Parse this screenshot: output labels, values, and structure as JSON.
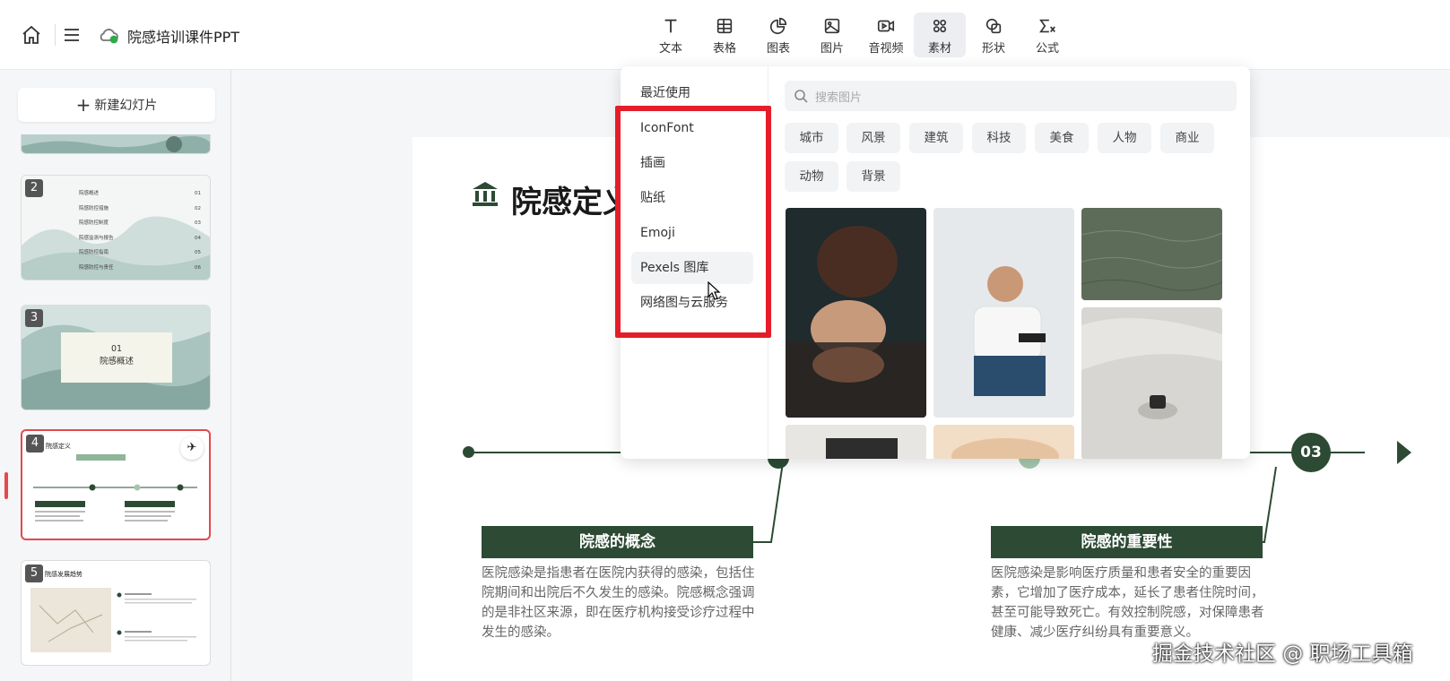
{
  "header": {
    "doc_title": "院感培训课件PPT",
    "tools": [
      {
        "label": "文本",
        "icon": "text-icon"
      },
      {
        "label": "表格",
        "icon": "table-icon"
      },
      {
        "label": "图表",
        "icon": "chart-icon"
      },
      {
        "label": "图片",
        "icon": "image-icon"
      },
      {
        "label": "音视频",
        "icon": "video-icon"
      },
      {
        "label": "素材",
        "icon": "assets-icon"
      },
      {
        "label": "形状",
        "icon": "shape-icon"
      },
      {
        "label": "公式",
        "icon": "formula-icon"
      }
    ],
    "active_tool": "素材"
  },
  "sidebar": {
    "new_slide_label": "新建幻灯片",
    "thumbs": [
      {
        "num": "2",
        "lines": [
          "院感概述",
          "院感防控措施",
          "院感防控制度",
          "院感监测与报告",
          "院感防控指南",
          "院感防控与责任"
        ],
        "pages": [
          "01",
          "02",
          "03",
          "04",
          "05",
          "06"
        ]
      },
      {
        "num": "3",
        "line1": "01",
        "line2": "院感概述"
      },
      {
        "num": "4",
        "title": "院感定义",
        "selected": true
      },
      {
        "num": "5",
        "title": "院感发展趋势"
      }
    ]
  },
  "slide": {
    "title": "院感定义",
    "node_label": "03",
    "sections": [
      {
        "header": "院感的概念",
        "body": "医院感染是指患者在医院内获得的感染，包括住院期间和出院后不久发生的感染。院感概念强调的是非社区来源，即在医疗机构接受诊疗过程中发生的感染。"
      },
      {
        "header": "院感的重要性",
        "body": "医院感染是影响医疗质量和患者安全的重要因素，它增加了医疗成本，延长了患者住院时间，甚至可能导致死亡。有效控制院感，对保障患者健康、减少医疗纠纷具有重要意义。"
      }
    ]
  },
  "popup": {
    "categories": [
      "最近使用",
      "IconFont",
      "插画",
      "贴纸",
      "Emoji",
      "Pexels 图库",
      "网络图与云服务"
    ],
    "hovered": "Pexels 图库",
    "search_placeholder": "搜索图片",
    "tags": [
      "城市",
      "风景",
      "建筑",
      "科技",
      "美食",
      "人物",
      "商业",
      "动物",
      "背景"
    ]
  },
  "watermark": "掘金技术社区 @ 职场工具箱",
  "colors": {
    "accent_green": "#2c4a34",
    "highlight_red": "#e51d2a",
    "selection_red": "#e5484d"
  }
}
